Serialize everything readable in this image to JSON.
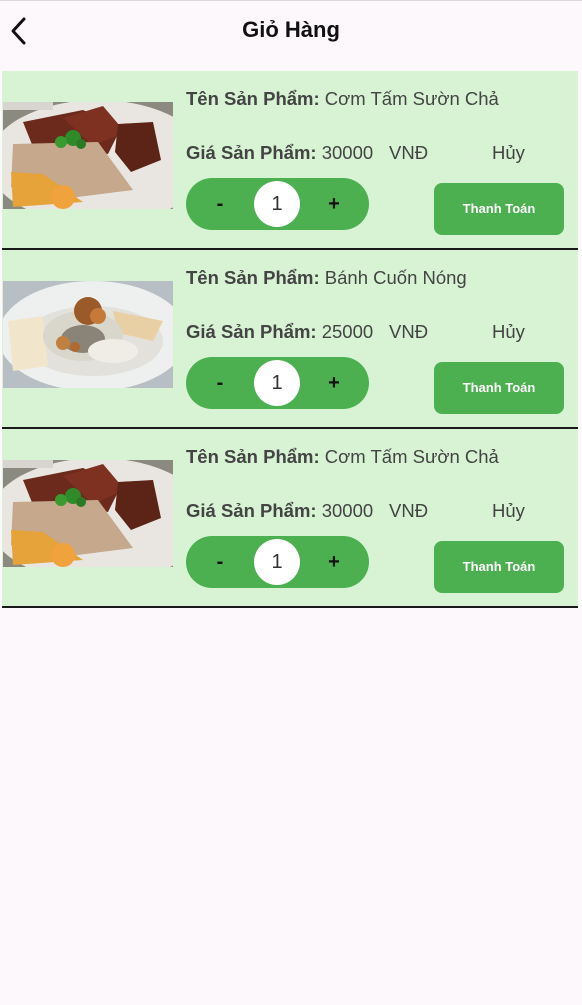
{
  "header": {
    "title": "Giỏ Hàng",
    "back_icon": "chevron-left-icon"
  },
  "labels": {
    "name_label": "Tên Sản Phẩm:",
    "price_label": "Giá Sản Phẩm:",
    "currency": "VNĐ",
    "cancel": "Hủy",
    "pay": "Thanh Toán",
    "minus": "-",
    "plus": "+"
  },
  "colors": {
    "accent": "#4caf50",
    "item_bg": "#d7f3d4",
    "page_bg": "#fdf8fc"
  },
  "items": [
    {
      "name": "Cơm Tấm Sườn Chả",
      "price": "30000",
      "quantity": "1",
      "image": "com-tam-photo"
    },
    {
      "name": "Bánh Cuốn Nóng",
      "price": "25000",
      "quantity": "1",
      "image": "banh-cuon-photo"
    },
    {
      "name": "Cơm Tấm Sườn Chả",
      "price": "30000",
      "quantity": "1",
      "image": "com-tam-photo"
    }
  ]
}
